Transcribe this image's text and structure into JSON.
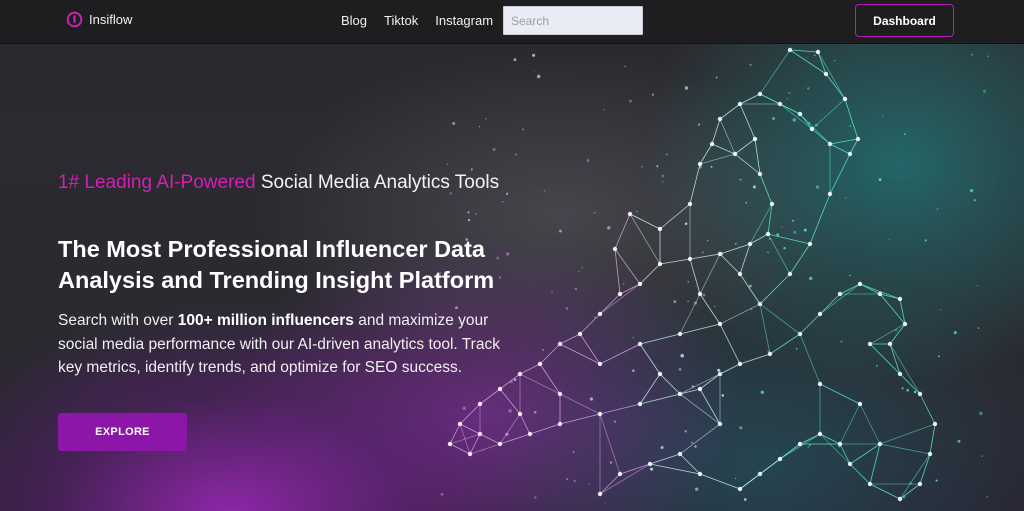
{
  "nav": {
    "brand": "Insiflow",
    "links": [
      "Blog",
      "Tiktok",
      "Instagram"
    ],
    "search_placeholder": "Search",
    "dashboard_label": "Dashboard"
  },
  "hero": {
    "tagline_accent": "1# Leading AI-Powered",
    "tagline_rest": " Social Media Analytics Tools",
    "headline": "The Most Professional Influencer Data Analysis and Trending Insight Platform",
    "desc_prefix": "Search with over ",
    "desc_bold": "100+ million influencers",
    "desc_suffix": " and maximize your social media performance with our AI-driven analytics tool. Track key metrics, identify trends, and optimize for SEO success.",
    "cta_label": "EXPLORE"
  },
  "colors": {
    "accent": "#d21fb4",
    "button": "#8c16a8",
    "nav_bg": "#1e1e21"
  },
  "icons": {
    "brand": "insiflow-logo-icon",
    "hero_art": "wireframe-horse-illustration"
  }
}
